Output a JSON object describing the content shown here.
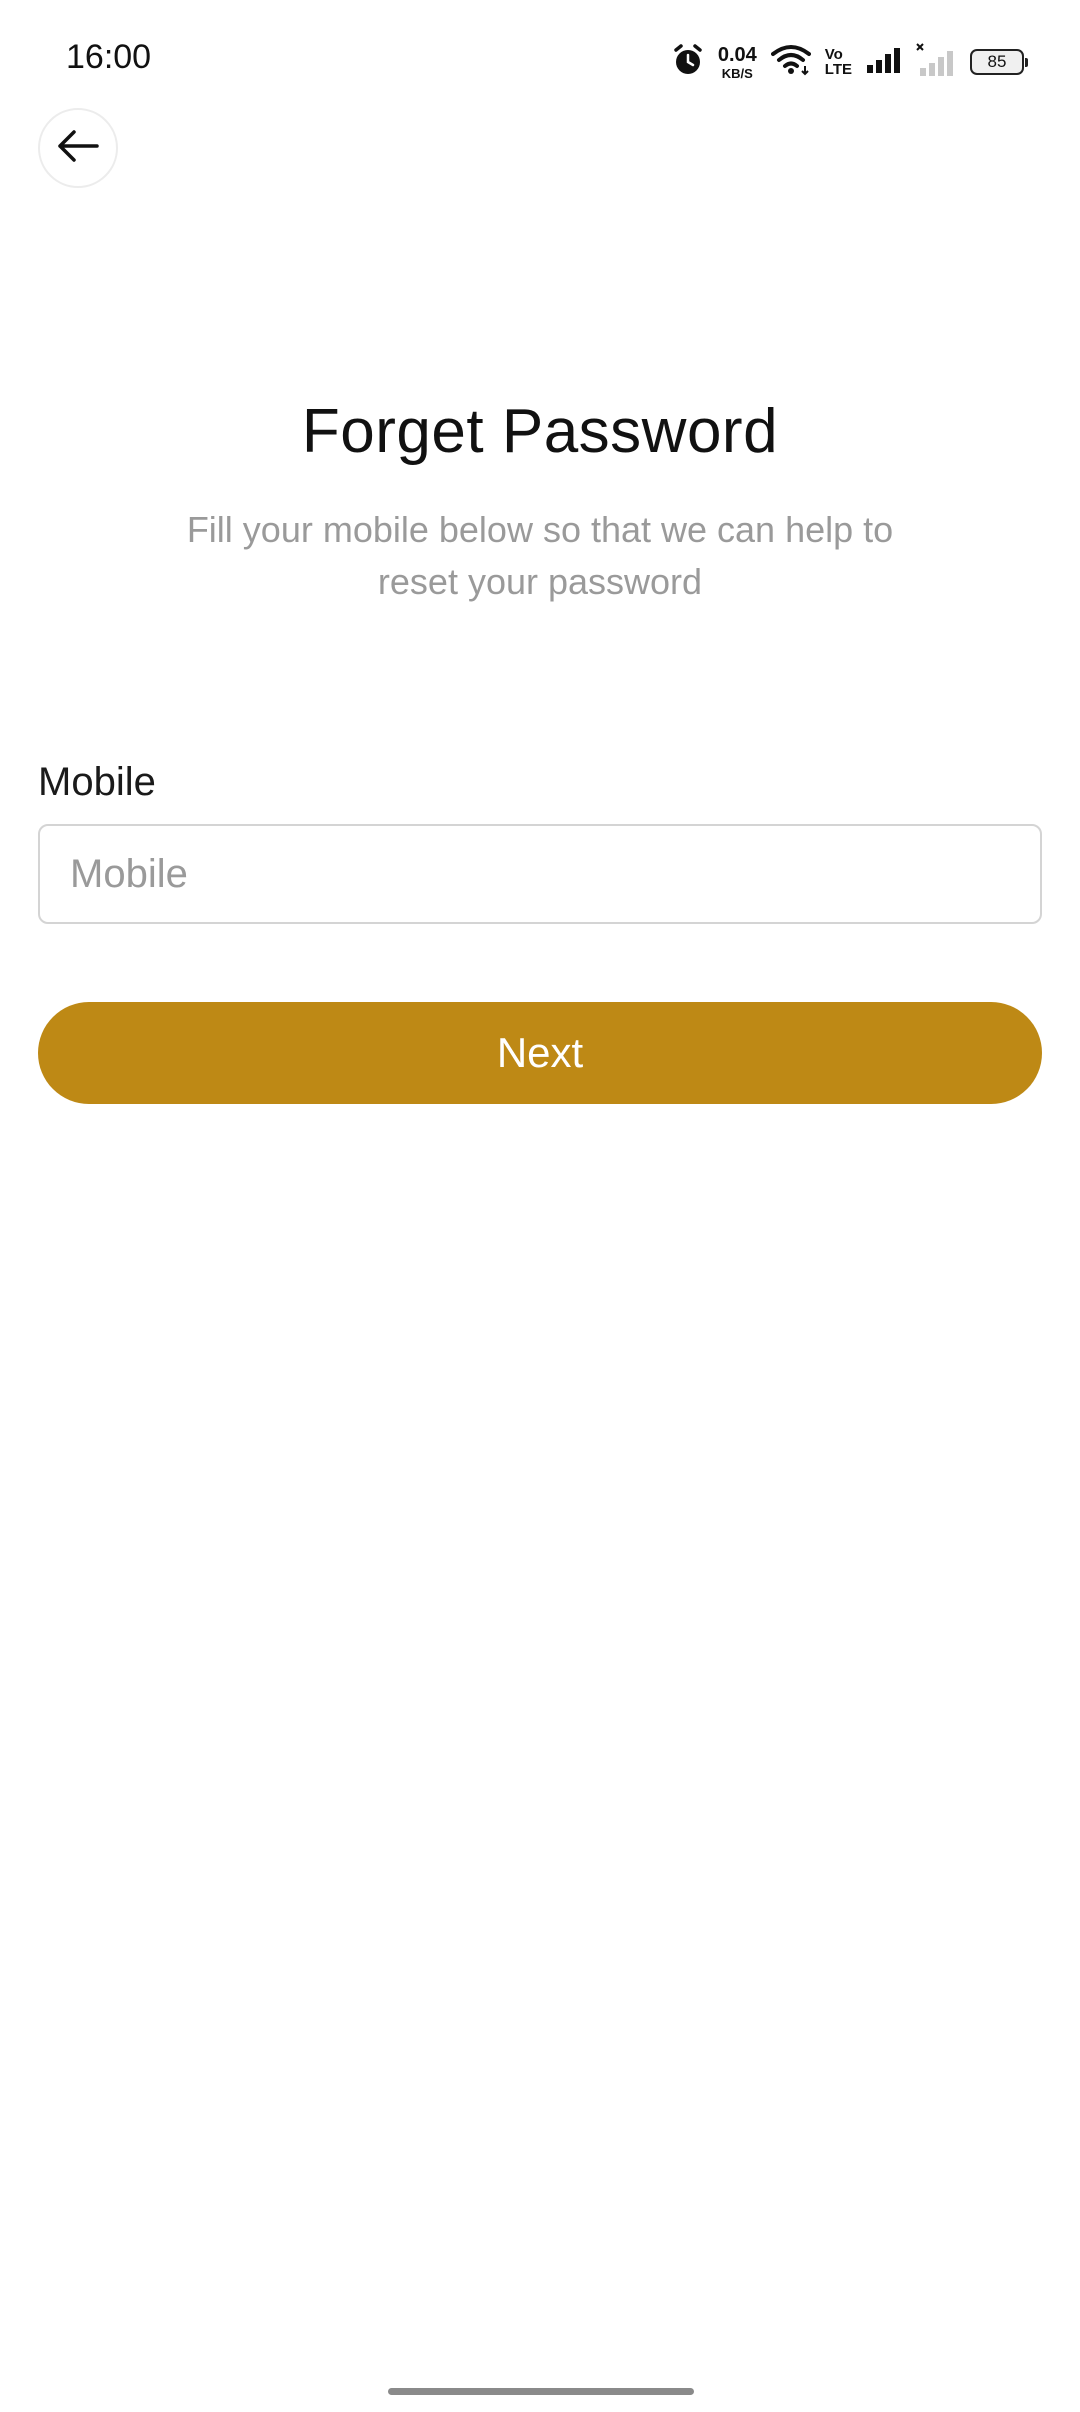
{
  "status_bar": {
    "time": "16:00",
    "net_speed_value": "0.04",
    "net_speed_unit": "KB/S",
    "volte_top": "Vo",
    "volte_bottom": "LTE",
    "battery_level": "85",
    "icons": [
      "alarm-icon",
      "wifi-icon",
      "volte-icon",
      "signal-icon",
      "signal-no-service-icon",
      "battery-icon"
    ]
  },
  "header": {
    "back_icon": "arrow-left-icon",
    "title": "Forget Password",
    "subtitle": "Fill your mobile below so that we can help to reset your password"
  },
  "form": {
    "mobile_label": "Mobile",
    "mobile_value": "",
    "mobile_placeholder": "Mobile",
    "next_label": "Next"
  },
  "colors": {
    "accent": "#be8915",
    "subtitle_text": "#9a9a9a",
    "input_border": "#d4d4d4"
  }
}
